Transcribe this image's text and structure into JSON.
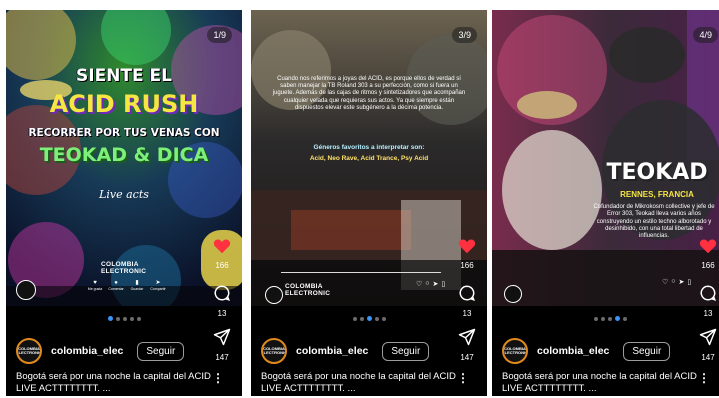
{
  "posts": [
    {
      "counter": "1/9",
      "headline_1": "SIENTE EL",
      "headline_2": "ACID RUSH",
      "headline_3": "RECORRER POR TUS VENAS CON",
      "headline_4": "TEOKAD & DICA",
      "sub": "Live acts",
      "brand_line1": "COLOMBIA",
      "brand_line2": "ELECTRONIC",
      "mini_actions": [
        "Me gusta",
        "Comentar",
        "Guardar",
        "Compartir"
      ],
      "likes": "166",
      "comments": "13",
      "shares": "147",
      "username": "colombia_elec",
      "follow_label": "Seguir",
      "caption": "Bogotá será por una noche la capital del ACID LIVE ACTTTTTTTT. ..."
    },
    {
      "counter": "3/9",
      "body_text": "Cuando nos referimos a joyas del ACID, es porque ellos de verdad sí saben manejar la TB Roland 303 a su perfección, como si fuera un juguete. Además de las cajas de ritmos y sintetizadores que acompañan cualquier velada que requieras sus actos. Ya que siempre están dispuestos elevar este subgénero a la décima potencia.",
      "genres_title": "Géneros favoritos a interpretar son:",
      "genres_list": "Acid, Neo Rave, Acid Trance, Psy Acid",
      "brand_line1": "COLOMBIA",
      "brand_line2": "ELECTRONIC",
      "likes": "166",
      "comments": "13",
      "shares": "147",
      "username": "colombia_elec",
      "follow_label": "Seguir",
      "caption": "Bogotá será por una noche la capital del ACID LIVE ACTTTTTTTT. ..."
    },
    {
      "counter": "4/9",
      "artist_name": "TEOKAD",
      "artist_origin": "RENNES, FRANCIA",
      "artist_bio": "Cofundador de Mikrokosm collective y jefe de Error 303, Teokad lleva varios años construyendo un estilo techno alborotado y desinhibido, con una total libertad de influencias.",
      "likes": "166",
      "comments": "13",
      "shares": "147",
      "username": "colombia_elec",
      "follow_label": "Seguir",
      "caption": "Bogotá será por una noche la capital del ACID LIVE ACTTTTTTTT. ..."
    }
  ],
  "avatar_text": "COLOMBIA ELECTRONIC",
  "colors": {
    "accent_blue": "#3b95f6",
    "heart_red": "#ff3040",
    "avatar_ring": "#e08a1e",
    "headline_yellow": "#f5e642",
    "headline_green": "#7df07a"
  }
}
